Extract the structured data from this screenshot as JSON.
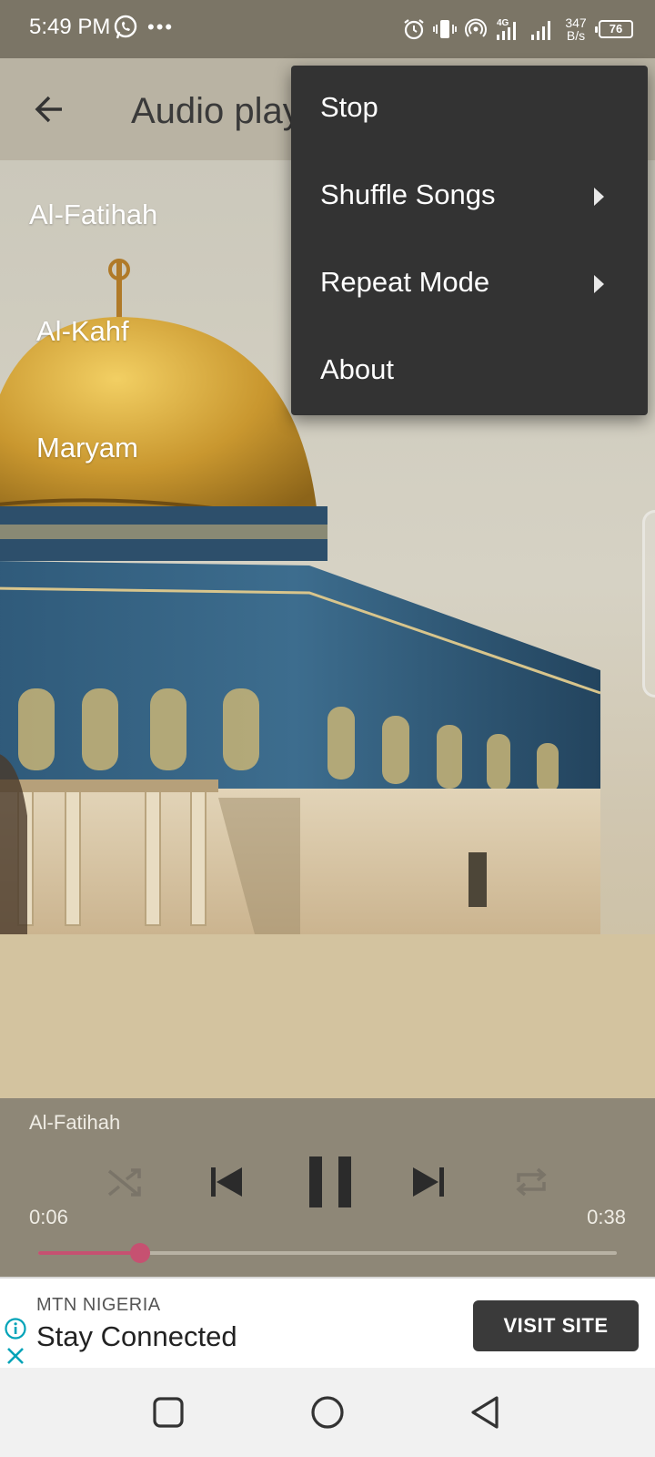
{
  "status_bar": {
    "time": "5:49 PM",
    "net_speed_value": "347",
    "net_speed_unit": "B/s",
    "battery": "76",
    "icons": [
      "whatsapp-icon",
      "more-dots-icon",
      "alarm-icon",
      "vibrate-icon",
      "hotspot-icon",
      "signal-4g-icon",
      "signal-icon",
      "battery-icon"
    ]
  },
  "app_bar": {
    "title": "Audio player"
  },
  "playlist": {
    "items": [
      "Al-Fatihah",
      "Al-Kahf",
      "Maryam"
    ]
  },
  "player": {
    "now_playing": "Al-Fatihah",
    "current_time": "0:06",
    "duration": "0:38",
    "progress_fraction": 0.176,
    "accent_color": "#c65171"
  },
  "menu": {
    "items": [
      {
        "label": "Stop",
        "has_submenu": false
      },
      {
        "label": "Shuffle Songs",
        "has_submenu": true
      },
      {
        "label": "Repeat Mode",
        "has_submenu": true
      },
      {
        "label": "About",
        "has_submenu": false
      }
    ]
  },
  "ad": {
    "brand": "MTN NIGERIA",
    "headline": "Stay Connected",
    "cta": "VISIT SITE"
  }
}
